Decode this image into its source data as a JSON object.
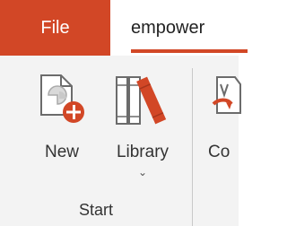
{
  "tabs": {
    "file_label": "File",
    "active_label": "empower"
  },
  "ribbon": {
    "groups": [
      {
        "label": "Start",
        "commands": [
          {
            "label": "New",
            "icon": "new-document-icon"
          },
          {
            "label": "Library",
            "icon": "library-icon",
            "has_dropdown": true,
            "dropdown_glyph": "⌄"
          }
        ]
      },
      {
        "commands": [
          {
            "label": "Co",
            "icon": "convert-icon"
          }
        ]
      }
    ]
  },
  "colors": {
    "accent": "#d24726",
    "ribbon_bg": "#f3f3f3",
    "text": "#333333"
  }
}
